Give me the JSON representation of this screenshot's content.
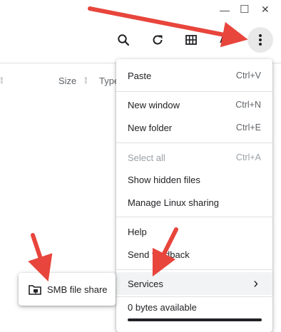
{
  "window_controls": {
    "minimize": "—",
    "maximize": "☐",
    "close": "✕"
  },
  "toolbar": {
    "search_icon": "search-icon",
    "refresh_icon": "refresh-icon",
    "grid_icon": "grid-view-icon",
    "sort_label": "AZ",
    "more_icon": "more-vert-icon"
  },
  "columns": {
    "size": "Size",
    "type": "Type"
  },
  "menu": {
    "paste": {
      "label": "Paste",
      "shortcut": "Ctrl+V"
    },
    "new_window": {
      "label": "New window",
      "shortcut": "Ctrl+N"
    },
    "new_folder": {
      "label": "New folder",
      "shortcut": "Ctrl+E"
    },
    "select_all": {
      "label": "Select all",
      "shortcut": "Ctrl+A"
    },
    "show_hidden": {
      "label": "Show hidden files"
    },
    "linux_sharing": {
      "label": "Manage Linux sharing"
    },
    "help": {
      "label": "Help"
    },
    "feedback": {
      "label": "Send feedback"
    },
    "services": {
      "label": "Services",
      "chevron": "›"
    },
    "storage": {
      "label": "0 bytes available",
      "used_fraction": 1.0
    }
  },
  "submenu": {
    "smb": "SMB file share"
  },
  "colors": {
    "annotation_arrow": "#e8453c"
  }
}
